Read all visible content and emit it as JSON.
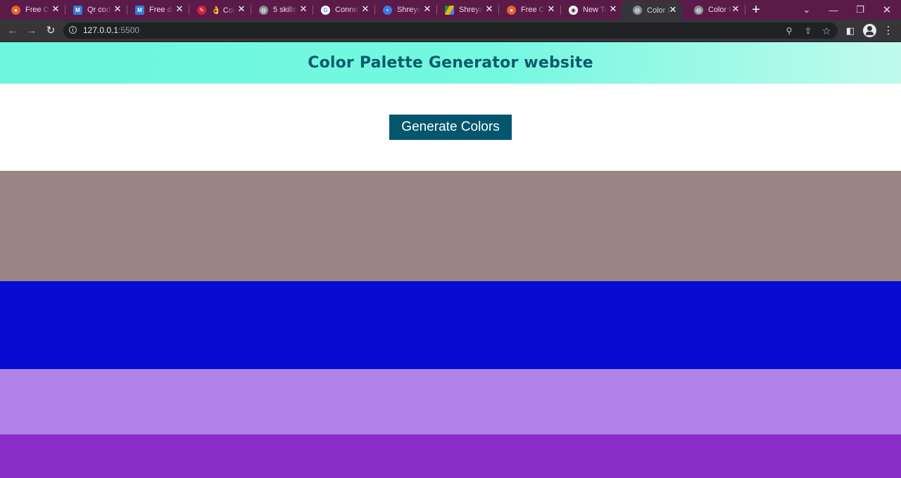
{
  "browser": {
    "tabs": [
      {
        "title": "Free Online",
        "favicon": "orange-globe-icon",
        "color": "#e8622c"
      },
      {
        "title": "Qr code",
        "favicon": "blue-m-icon",
        "color": "#2f7fd6"
      },
      {
        "title": "Free download",
        "favicon": "blue-m-icon",
        "color": "#2f7fd6"
      },
      {
        "title": "👌 Color",
        "favicon": "red-pin-icon",
        "color": "#d6203a"
      },
      {
        "title": "5 skills",
        "favicon": "globe-icon",
        "color": "#8a8f95"
      },
      {
        "title": "Connect",
        "favicon": "google-g-icon",
        "color": "#ffffff"
      },
      {
        "title": "Shreyas",
        "favicon": "chat-icon",
        "color": "#3b7be8"
      },
      {
        "title": "Shreyas",
        "favicon": "drive-icon",
        "color": "#f2b600"
      },
      {
        "title": "Free Online",
        "favicon": "orange-globe-icon",
        "color": "#e8622c"
      },
      {
        "title": "New Tab",
        "favicon": "chrome-icon",
        "color": "#ffffff"
      },
      {
        "title": "Color Palette",
        "favicon": "globe-icon",
        "color": "#8a8f95",
        "active": true
      },
      {
        "title": "Color Palette",
        "favicon": "globe-icon",
        "color": "#8a8f95"
      }
    ],
    "url_host": "127.0.0.1",
    "url_port": ":5500"
  },
  "page": {
    "title": "Color Palette Generator website",
    "button_label": "Generate Colors",
    "swatches": [
      "#9b8584",
      "#060bcf",
      "#b183e8",
      "#8b2ec9"
    ]
  }
}
